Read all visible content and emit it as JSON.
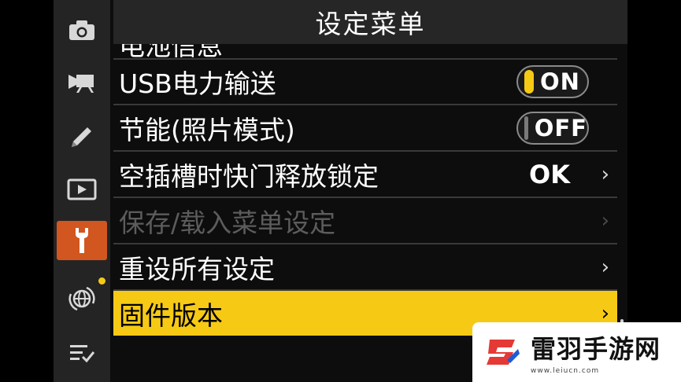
{
  "header": {
    "title": "设定菜单"
  },
  "sidebar": {
    "items": [
      {
        "icon": "camera-icon"
      },
      {
        "icon": "movie-camera-icon"
      },
      {
        "icon": "pencil-icon"
      },
      {
        "icon": "playback-icon"
      },
      {
        "icon": "wrench-icon",
        "active": true
      },
      {
        "icon": "network-globe-icon",
        "badge": true
      },
      {
        "icon": "my-menu-icon"
      }
    ]
  },
  "menu": {
    "clipped_item": "电池信息",
    "items": [
      {
        "label": "USB电力输送",
        "toggle": "ON",
        "toggle_state": true
      },
      {
        "label": "节能(照片模式)",
        "toggle": "OFF",
        "toggle_state": false
      },
      {
        "label": "空插槽时快门释放锁定",
        "value": "OK",
        "chevron": "›"
      },
      {
        "label": "保存/载入菜单设定",
        "chevron": "›",
        "disabled": true
      },
      {
        "label": "重设所有设定",
        "chevron": "›"
      },
      {
        "label": "固件版本",
        "chevron": "›",
        "selected": true
      }
    ]
  },
  "colors": {
    "accent": "#f6c915",
    "active_tab": "#d1561f",
    "background": "#0d0d0d"
  },
  "watermark": {
    "title": "雷羽手游网",
    "url": "www.leiucn.com"
  }
}
